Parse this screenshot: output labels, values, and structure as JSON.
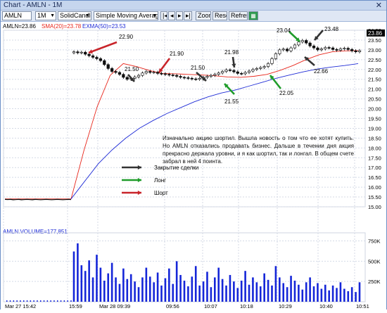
{
  "window": {
    "title": "Chart - AMLN - 1M",
    "close": "✕"
  },
  "toolbar": {
    "symbol": "AMLN",
    "interval": "1M",
    "chart_type": "SolidCandle",
    "indicator": "Simple Moving Average",
    "zoom_label": "Zoom",
    "reset_label": "Reset",
    "refresh_label": "Refresh"
  },
  "legend": {
    "price": "AMLN=23.86",
    "sma": "SMA(20)=23.78",
    "exma": "EXMA(50)=23.53",
    "volume": "AMLN.VOLUME=177,851"
  },
  "colors": {
    "sma": "#e8261b",
    "exma": "#1e2bd6",
    "volume": "#1526d8",
    "candle_up": "#ffffff",
    "candle_down": "#111111",
    "arrow_close": "#333333",
    "arrow_long": "#1f9c2a",
    "arrow_short": "#c8242a"
  },
  "price_axis": {
    "ticks": [
      "24.00",
      "23.50",
      "23.00",
      "22.50",
      "22.00",
      "21.50",
      "21.00",
      "20.50",
      "20.00",
      "19.50",
      "19.00",
      "18.50",
      "18.00",
      "17.50",
      "17.00",
      "16.50",
      "16.00",
      "15.50",
      "15.00"
    ],
    "last_price": "23.86",
    "ylim": [
      15.0,
      24.0
    ]
  },
  "volume_axis": {
    "ticks": [
      "750K",
      "500K",
      "250K"
    ],
    "ylim": [
      0,
      850000
    ]
  },
  "time_axis": {
    "labels": [
      "Mar 27 15:42",
      "15:59",
      "Mar 28 09:39",
      "09:56",
      "10:07",
      "10:18",
      "10:29",
      "10:40",
      "10:51"
    ]
  },
  "price_annotations": [
    "22.90",
    "21.50",
    "21.90",
    "21.50",
    "21.98",
    "21.55",
    "23.04",
    "23.48",
    "22.66",
    "22.05"
  ],
  "annotation_text": "Изначально акцию шортил. Вышла новость о том что ее хотят купить. Но AMLN отказались продавать бизнес.     Дальше в течении дня акция прекрасно держала уровни, и я как шортил, так и лонгал.   В общем счете забрал в ней 4 поинта.",
  "key": {
    "close": "Закрытие сделки",
    "long": "Лонг",
    "short": "Шорт"
  },
  "chart_data": {
    "type": "line",
    "price_series": {
      "name": "AMLN",
      "pre_x": [
        0,
        1,
        2,
        3,
        4,
        5,
        6,
        7,
        8,
        9,
        10,
        11,
        12,
        13,
        14,
        15,
        16,
        17,
        18,
        19,
        20,
        21,
        22,
        23,
        24
      ],
      "pre_close": [
        15.38,
        15.37,
        15.38,
        15.36,
        15.37,
        15.38,
        15.36,
        15.37,
        15.38,
        15.37,
        15.36,
        15.38,
        15.37,
        15.36,
        15.37,
        15.38,
        15.37,
        15.36,
        15.37,
        15.38,
        15.37,
        15.36,
        15.37,
        15.38,
        15.37
      ],
      "close": [
        22.9,
        22.85,
        22.88,
        22.78,
        22.7,
        22.62,
        22.55,
        22.45,
        22.25,
        22.05,
        21.9,
        21.85,
        21.75,
        21.6,
        21.5,
        21.55,
        21.62,
        21.7,
        21.82,
        21.9,
        21.85,
        21.86,
        21.8,
        21.78,
        21.75,
        21.72,
        21.7,
        21.65,
        21.6,
        21.58,
        21.55,
        21.52,
        21.5,
        21.55,
        21.6,
        21.65,
        21.7,
        21.75,
        21.82,
        21.9,
        21.98,
        21.95,
        21.88,
        21.8,
        21.78,
        21.85,
        21.92,
        22.0,
        22.05,
        22.1,
        22.15,
        22.3,
        22.55,
        22.8,
        23.0,
        23.04,
        22.95,
        23.1,
        23.25,
        23.4,
        23.48,
        23.35,
        23.2,
        23.1,
        23.0,
        23.05,
        23.12,
        23.1,
        23.02,
        22.98,
        23.05,
        23.08,
        23.02,
        22.95,
        22.9,
        22.96
      ]
    },
    "sma20": [
      15.4,
      17.9,
      20.1,
      21.7,
      22.3,
      22.15,
      21.95,
      21.8,
      21.78,
      21.75,
      21.72,
      21.68,
      21.62,
      21.6,
      21.65,
      21.75,
      21.95,
      22.2,
      22.5,
      22.75,
      22.9,
      22.95,
      22.96
    ],
    "exma50": [
      15.4,
      16.3,
      17.2,
      17.9,
      18.5,
      19.0,
      19.4,
      19.75,
      20.05,
      20.35,
      20.6,
      20.8,
      20.95,
      21.15,
      21.35,
      21.55,
      21.72,
      21.88,
      22.02,
      22.12,
      22.2,
      22.3
    ],
    "volume": [
      620000,
      720000,
      450000,
      380000,
      510000,
      300000,
      580000,
      420000,
      260000,
      350000,
      480000,
      300000,
      220000,
      410000,
      280000,
      340000,
      250000,
      180000,
      300000,
      420000,
      310000,
      240000,
      360000,
      200000,
      290000,
      410000,
      220000,
      500000,
      330000,
      260000,
      190000,
      310000,
      440000,
      200000,
      250000,
      370000,
      180000,
      300000,
      420000,
      280000,
      200000,
      330000,
      250000,
      170000,
      260000,
      380000,
      210000,
      300000,
      240000,
      190000,
      350000,
      270000,
      200000,
      440000,
      300000,
      230000,
      180000,
      320000,
      260000,
      210000,
      150000,
      240000,
      300000,
      190000,
      230000,
      160000,
      210000,
      140000,
      200000,
      170000,
      240000,
      160000,
      130000,
      180000,
      120000,
      240000
    ]
  }
}
